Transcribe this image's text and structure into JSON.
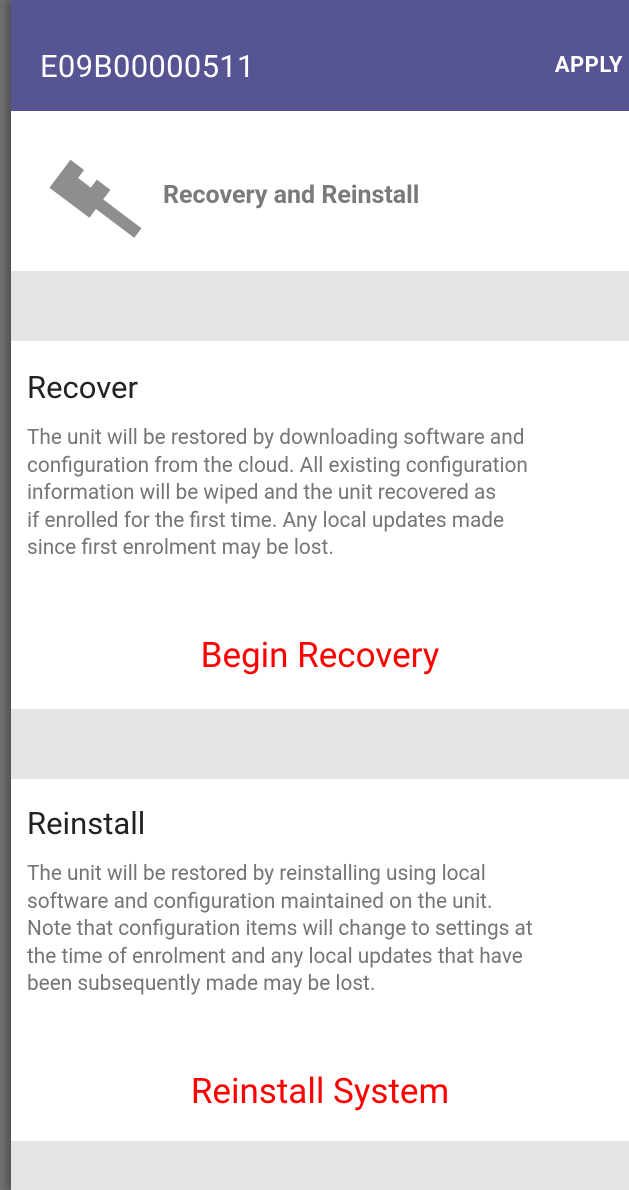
{
  "app_bar": {
    "title": "E09B00000511",
    "apply_label": "APPLY",
    "background_color": "#575494"
  },
  "header": {
    "icon": "wrench-icon",
    "title": "Recovery and Reinstall"
  },
  "sections": [
    {
      "title": "Recover",
      "description": "The unit will be restored by downloading software and\nconfiguration from the cloud. All existing configuration\ninformation will be wiped and the unit recovered as\nif enrolled for the first time. Any local updates made\nsince first enrolment may be lost.",
      "action_label": "Begin Recovery"
    },
    {
      "title": "Reinstall",
      "description": "The unit will be restored by reinstalling using local\nsoftware and configuration maintained on the unit.\nNote that configuration items will change to settings at\nthe time of enrolment and any local updates that have\nbeen subsequently made may be lost.",
      "action_label": "Reinstall System"
    }
  ],
  "colors": {
    "action": "#ff0000",
    "spacer": "#e4e4e4",
    "body_text": "#757575"
  }
}
